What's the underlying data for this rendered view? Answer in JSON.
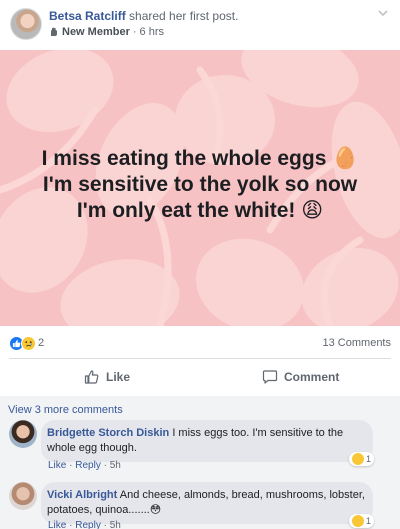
{
  "post": {
    "author": "Betsa Ratcliff",
    "action": "shared her first post.",
    "badge": "New Member",
    "separator": "·",
    "time": "6 hrs",
    "text_lines": [
      "I miss eating the whole eggs 🥚",
      "I'm sensitive to the yolk so now",
      "I'm only eat the white! 😩"
    ],
    "background_color": "#f7c2c4"
  },
  "stats": {
    "reaction_count": "2",
    "comments_count": "13 Comments",
    "reaction_types": [
      "like",
      "sad"
    ]
  },
  "actions": {
    "like_label": "Like",
    "comment_label": "Comment"
  },
  "comments_section": {
    "view_more_label": "View 3 more comments",
    "comments": [
      {
        "author": "Bridgette Storch Diskin",
        "text": "I miss eggs too. I'm sensitive to the whole egg though.",
        "like_label": "Like",
        "reply_label": "Reply",
        "time": "5h",
        "reaction_count": "1"
      },
      {
        "author": "Vicki Albright",
        "text": "And cheese, almonds, bread, mushrooms, lobster, potatoes, quinoa.......😳",
        "like_label": "Like",
        "reply_label": "Reply",
        "time": "5h",
        "reaction_count": "1"
      }
    ]
  },
  "colors": {
    "link_blue": "#385898",
    "meta_gray": "#606770",
    "like_blue": "#1877f2",
    "sad_yellow": "#f7c736",
    "comments_bg": "#f2f3f5"
  },
  "icons": [
    "avatar",
    "wave-icon",
    "chevron-down-icon",
    "like-reaction-icon",
    "sad-reaction-icon",
    "thumbs-up-icon",
    "comment-bubble-icon"
  ]
}
